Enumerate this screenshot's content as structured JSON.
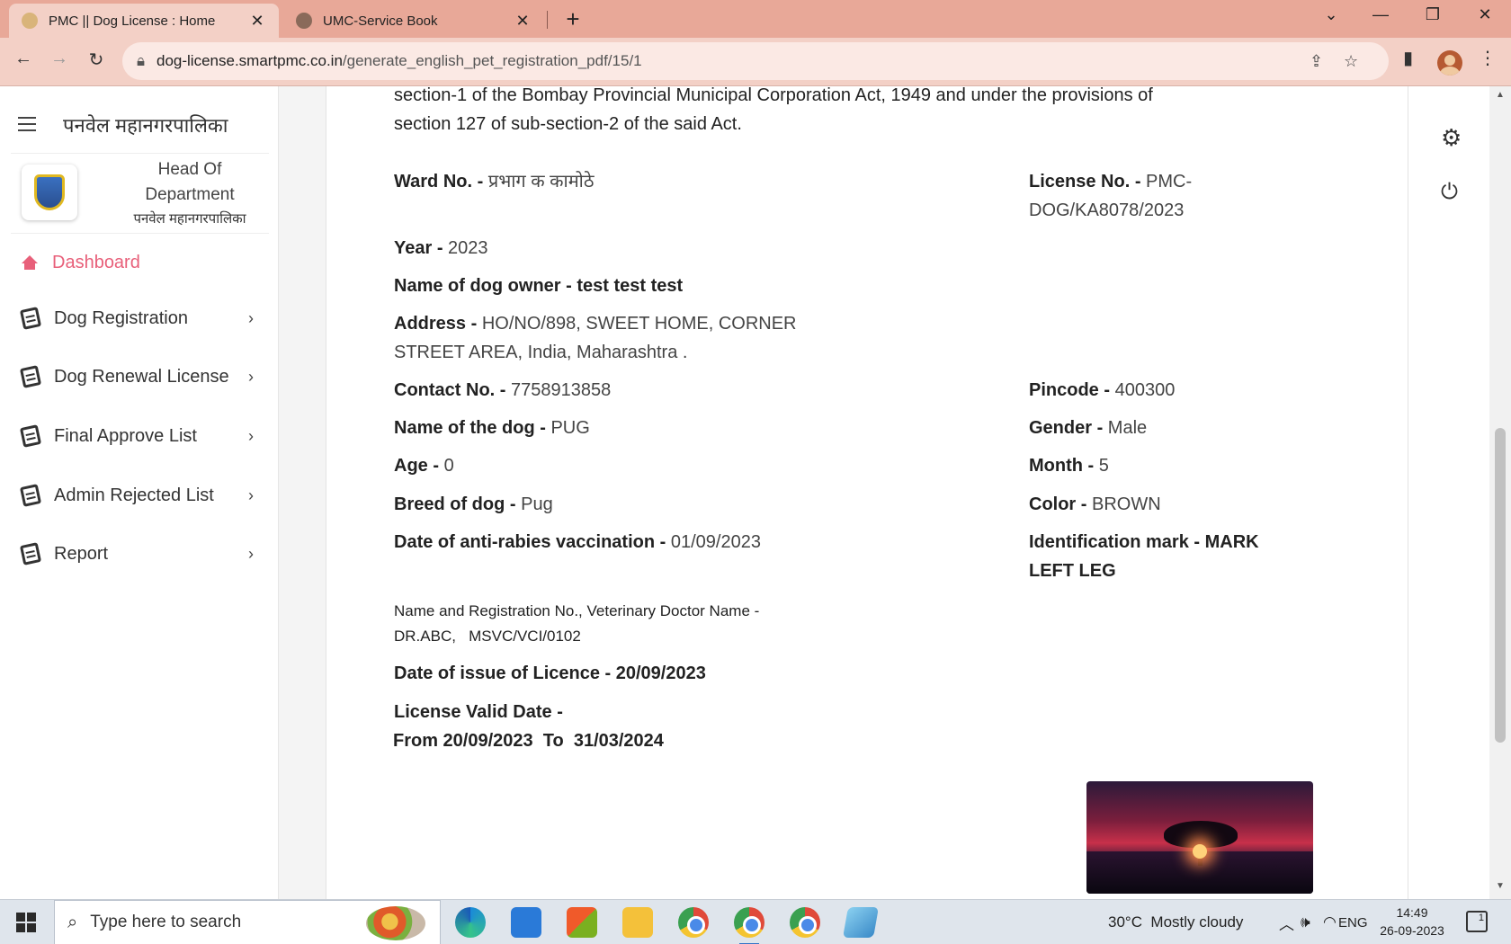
{
  "browser": {
    "tabs": [
      {
        "title": "PMC || Dog License : Home",
        "active": true
      },
      {
        "title": "UMC-Service Book",
        "active": false
      }
    ],
    "url_host": "dog-license.smartpmc.co.in",
    "url_path": "/generate_english_pet_registration_pdf/15/1"
  },
  "sidebar": {
    "brand": "पनवेल महानगरपालिका",
    "profile_role_line1": "Head Of",
    "profile_role_line2": "Department",
    "profile_org": "पनवेल महानगरपालिका",
    "items": [
      {
        "label": "Dashboard"
      },
      {
        "label": "Dog Registration"
      },
      {
        "label": "Dog Renewal License"
      },
      {
        "label": "Final Approve List"
      },
      {
        "label": "Admin Rejected List"
      },
      {
        "label": "Report"
      }
    ]
  },
  "document": {
    "intro_line1": "section-1 of the Bombay Provincial Municipal Corporation Act, 1949 and under the provisions of",
    "intro_line2": "section 127 of sub-section-2 of the said Act.",
    "ward_label": "Ward No. - ",
    "ward_value": "प्रभाग क  कामोठे",
    "license_label": "License No. - ",
    "license_value1": "PMC-",
    "license_value2": "DOG/KA8078/2023",
    "year_label": "Year - ",
    "year_value": "2023",
    "owner_label": "Name of dog owner - ",
    "owner_value": "test test test",
    "address_label": "Address - ",
    "address_line1": "HO/NO/898, SWEET HOME, CORNER",
    "address_line2": "STREET AREA, India, Maharashtra .",
    "contact_label": "Contact No. - ",
    "contact_value": "7758913858",
    "pincode_label": "Pincode - ",
    "pincode_value": "400300",
    "dogname_label": "Name of the dog - ",
    "dogname_value": "PUG",
    "gender_label": "Gender - ",
    "gender_value": "Male",
    "age_label": "Age - ",
    "age_value": "0",
    "month_label": "Month - ",
    "month_value": "5",
    "breed_label": "Breed of dog - ",
    "breed_value": "Pug",
    "color_label": "Color - ",
    "color_value": "BROWN",
    "vacc_label": "Date of anti-rabies vaccination - ",
    "vacc_value": "01/09/2023",
    "idmark_label": "Identification mark - ",
    "idmark_value1": "MARK",
    "idmark_value2": "LEFT LEG",
    "vet_line1": "Name and Registration No., Veterinary Doctor Name -",
    "vet_line2": "DR.ABC,   MSVC/VCI/0102",
    "issue_label": "Date of issue of Licence - ",
    "issue_value": "20/09/2023",
    "valid_label": "License Valid Date -",
    "valid_value": "From 20/09/2023  To  31/03/2024"
  },
  "taskbar": {
    "search_placeholder": "Type here to search",
    "weather": "30°C  Mostly cloudy",
    "language": "ENG",
    "time": "14:49",
    "date": "26-09-2023",
    "notifications": "1"
  },
  "colors": {
    "tabbar": "#e8a898",
    "toolbar": "#f3d0c6",
    "accent": "#e8607a"
  }
}
